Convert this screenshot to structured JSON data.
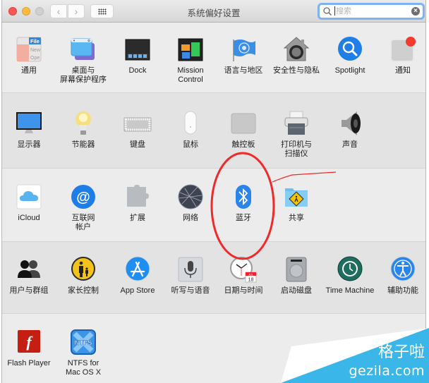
{
  "window": {
    "title": "系统偏好设置",
    "nav_back": "‹",
    "nav_forward": "›",
    "search": {
      "placeholder": "搜索",
      "value": "",
      "clear": "×"
    }
  },
  "sections": [
    {
      "panes": [
        {
          "id": "general",
          "label": "通用",
          "icon": "general-icon"
        },
        {
          "id": "desktop",
          "label": "桌面与\n屏幕保护程序",
          "icon": "desktop-screensaver-icon"
        },
        {
          "id": "dock",
          "label": "Dock",
          "icon": "dock-icon"
        },
        {
          "id": "mission",
          "label": "Mission\nControl",
          "icon": "mission-control-icon"
        },
        {
          "id": "language",
          "label": "语言与地区",
          "icon": "language-region-icon"
        },
        {
          "id": "security",
          "label": "安全性与隐私",
          "icon": "security-privacy-icon"
        },
        {
          "id": "spotlight",
          "label": "Spotlight",
          "icon": "spotlight-icon"
        },
        {
          "id": "notifications",
          "label": "通知",
          "icon": "notifications-icon"
        }
      ]
    },
    {
      "panes": [
        {
          "id": "displays",
          "label": "显示器",
          "icon": "display-icon"
        },
        {
          "id": "energy",
          "label": "节能器",
          "icon": "energy-saver-icon"
        },
        {
          "id": "keyboard",
          "label": "键盘",
          "icon": "keyboard-icon"
        },
        {
          "id": "mouse",
          "label": "鼠标",
          "icon": "mouse-icon"
        },
        {
          "id": "trackpad",
          "label": "触控板",
          "icon": "trackpad-icon"
        },
        {
          "id": "printers",
          "label": "打印机与\n扫描仪",
          "icon": "printer-icon"
        },
        {
          "id": "sound",
          "label": "声音",
          "icon": "speaker-icon"
        }
      ]
    },
    {
      "panes": [
        {
          "id": "icloud",
          "label": "iCloud",
          "icon": "icloud-icon"
        },
        {
          "id": "internet",
          "label": "互联网\n帐户",
          "icon": "internet-accounts-icon"
        },
        {
          "id": "extensions",
          "label": "扩展",
          "icon": "extensions-icon"
        },
        {
          "id": "network",
          "label": "网络",
          "icon": "network-icon"
        },
        {
          "id": "bluetooth",
          "label": "蓝牙",
          "icon": "bluetooth-icon"
        },
        {
          "id": "sharing",
          "label": "共享",
          "icon": "sharing-icon"
        }
      ]
    },
    {
      "panes": [
        {
          "id": "users",
          "label": "用户与群组",
          "icon": "users-groups-icon"
        },
        {
          "id": "parental",
          "label": "家长控制",
          "icon": "parental-controls-icon"
        },
        {
          "id": "appstore",
          "label": "App Store",
          "icon": "app-store-icon"
        },
        {
          "id": "dictation",
          "label": "听写与语音",
          "icon": "dictation-speech-icon"
        },
        {
          "id": "datetime",
          "label": "日期与时间",
          "icon": "date-time-icon"
        },
        {
          "id": "startup",
          "label": "启动磁盘",
          "icon": "startup-disk-icon"
        },
        {
          "id": "timemachine",
          "label": "Time Machine",
          "icon": "time-machine-icon"
        },
        {
          "id": "accessibility",
          "label": "辅助功能",
          "icon": "accessibility-icon"
        }
      ]
    },
    {
      "panes": [
        {
          "id": "flash",
          "label": "Flash Player",
          "icon": "flash-player-icon"
        },
        {
          "id": "ntfs",
          "label": "NTFS for\nMac OS X",
          "icon": "ntfs-icon"
        }
      ]
    }
  ],
  "icon_text": {
    "general_file": "File",
    "general_new": "New",
    "general_open": "Ope",
    "calendar_month": "JUL",
    "calendar_day": "18",
    "ntfs": "NTFS",
    "flash": "f"
  },
  "annotation": {
    "target": "蓝牙",
    "color": "#f02a2a"
  },
  "watermark": {
    "line1": "格子啦",
    "line2": "gezila.com",
    "color": "#3ab6e8"
  }
}
